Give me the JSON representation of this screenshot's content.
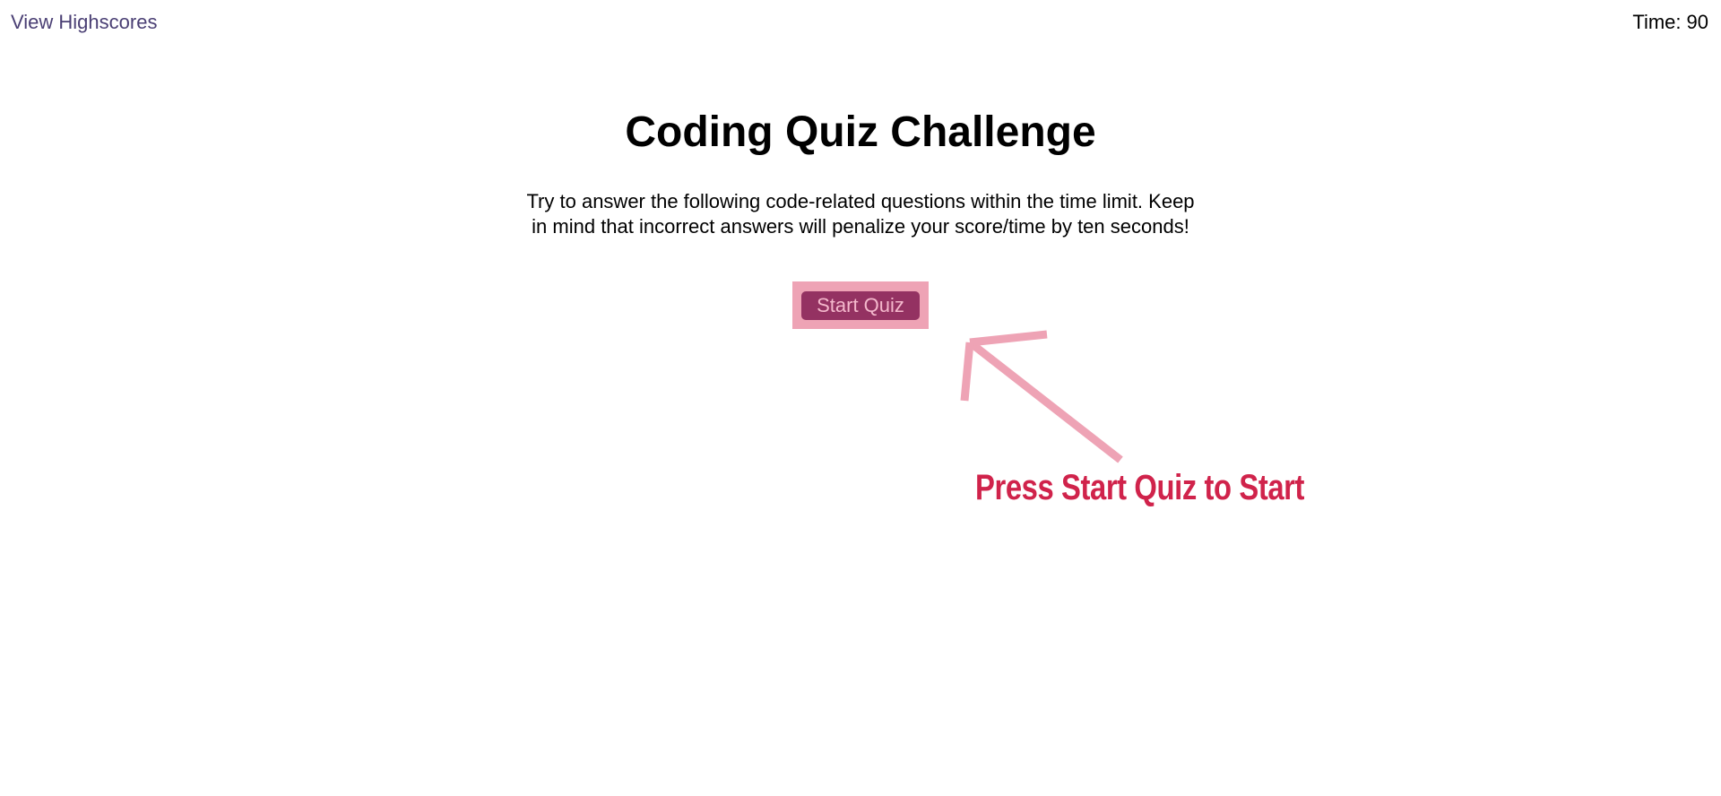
{
  "header": {
    "highscores_label": "View Highscores",
    "timer_label": "Time:",
    "timer_value": "90"
  },
  "main": {
    "title": "Coding Quiz Challenge",
    "intro": "Try to answer the following code-related questions within the time limit. Keep in mind that incorrect answers will penalize your score/time by ten seconds!",
    "start_button_label": "Start Quiz"
  },
  "annotation": {
    "text": "Press Start Quiz to Start",
    "icon": "arrow-up-left-icon",
    "color": "#d0234b",
    "arrow_color": "#eea3b5"
  },
  "colors": {
    "link": "#4a3f74",
    "button_bg": "#943262",
    "button_text": "#f4b8cc",
    "highlight": "#eea3b5"
  }
}
